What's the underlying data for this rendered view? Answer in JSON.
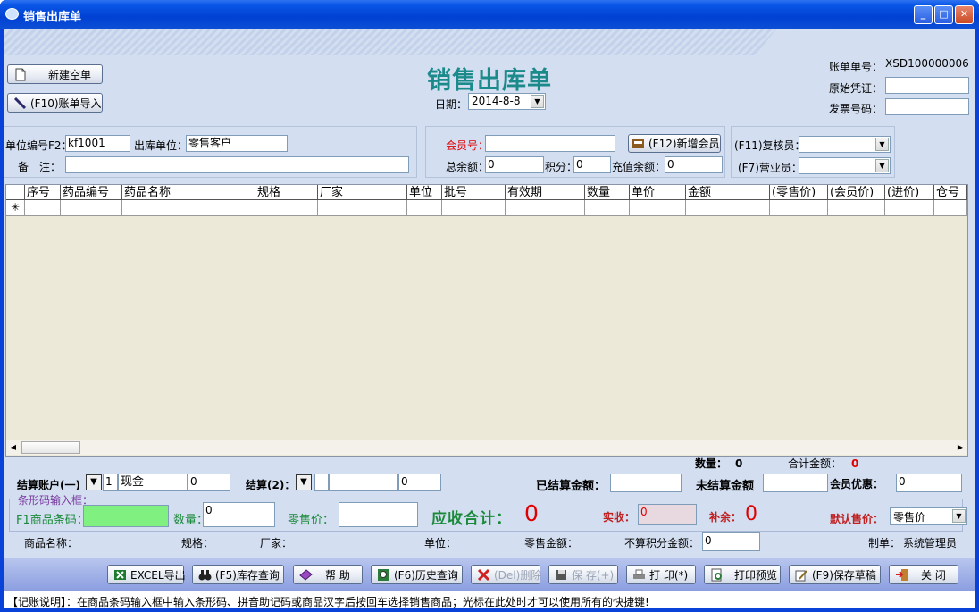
{
  "window": {
    "title": "销售出库单",
    "minimize": "_",
    "maximize": "□",
    "close": "✕"
  },
  "header": {
    "title": "销售出库单",
    "date_label": "日期：",
    "date_value": "2014-8-8",
    "account_no_label": "账单单号：",
    "account_no": "XSD100000006",
    "original_voucher_label": "原始凭证：",
    "original_voucher": "",
    "invoice_label": "发票号码：",
    "invoice": ""
  },
  "top_buttons": {
    "new_blank": "新建空单",
    "import_bill": "(F10)账单导入"
  },
  "unit": {
    "unit_code_label": "单位编号F2：",
    "unit_code": "kf1001",
    "out_unit_label": "出库单位：",
    "out_unit": "零售客户",
    "remark_label": "备　注：",
    "remark": ""
  },
  "member": {
    "member_no_label": "会员号：",
    "member_no": "",
    "add_member_button": "(F12)新增会员",
    "balance_label": "总余额：",
    "balance": "0",
    "points_label": "积分：",
    "points": "0",
    "recharge_label": "充值余额：",
    "recharge": "0"
  },
  "staff": {
    "reviewer_label": "(F11)复核员：",
    "reviewer": "",
    "clerk_label": "(F7)营业员：",
    "clerk": ""
  },
  "grid": {
    "columns": [
      "序号",
      "药品编号",
      "药品名称",
      "规格",
      "厂家",
      "单位",
      "批号",
      "有效期",
      "数量",
      "单价",
      "金额",
      "(零售价)",
      "(会员价)",
      "(进价)",
      "仓号"
    ],
    "new_row_marker": "✳",
    "row_values": []
  },
  "totals": {
    "quantity_label": "数量：",
    "quantity": "0",
    "total_amount_label": "合计金额：",
    "total_amount": "0"
  },
  "settlement": {
    "account_label": "结算账户(一)",
    "account_no": "1",
    "account_name": "现金",
    "account_amount": "0",
    "settle2_label": "结算(2)：",
    "settle2_name": "",
    "settle2_amount": "0",
    "settled_label": "已结算金额：",
    "settled": "",
    "unsettled_label": "未结算金额",
    "unsettled": "",
    "member_discount_label": "会员优惠：",
    "member_discount": "0"
  },
  "barcode": {
    "frame_label": "条形码输入框：",
    "barcode_label": "F1商品条码：",
    "barcode": "",
    "qty_label": "数量：",
    "qty": "0",
    "retail_price_label": "零售价：",
    "retail_price": "",
    "receivable_label": "应收合计：",
    "receivable": "0",
    "received_label": "实收：",
    "received": "0",
    "change_label": "补余：",
    "change": "0",
    "default_price_label": "默认售价：",
    "default_price": "零售价"
  },
  "info_row": {
    "product_name_label": "商品名称：",
    "spec_label": "规格：",
    "factory_label": "厂家：",
    "unit_label": "单位：",
    "retail_amount_label": "零售金额：",
    "non_points_label": "不算积分金额：",
    "non_points": "0",
    "maker_label": "制单：",
    "maker": "系统管理员"
  },
  "bottom_buttons": {
    "excel": "EXCEL导出",
    "stock_query": "(F5)库存查询",
    "help": "帮 助",
    "history": "(F6)历史查询",
    "delete": "(Del)删除",
    "save": "保 存(+)",
    "print": "打 印(*)",
    "preview": "打印预览",
    "draft": "(F9)保存草稿",
    "close": "关 闭"
  },
  "status_bar": "【记账说明】：在商品条码输入框中输入条形码、拼音助记码或商品汉字后按回车选择销售商品；光标在此处时才可以使用所有的快捷键!",
  "colors": {
    "title_bar": "#0a56e6",
    "panel": "#d3def0",
    "heading": "#1a8a8a",
    "red": "#e00000",
    "green_label": "#1a8a3a",
    "barcode_input": "#80f080"
  }
}
